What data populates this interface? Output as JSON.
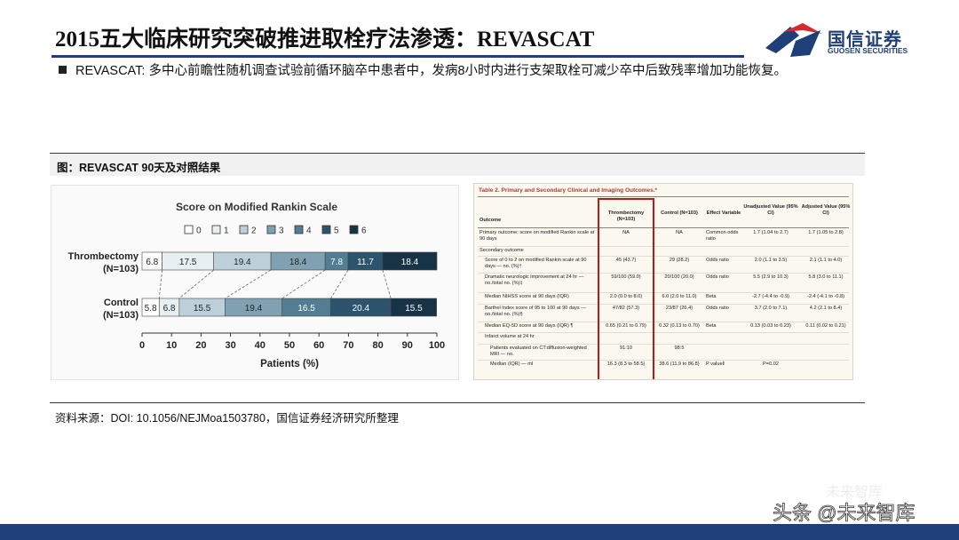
{
  "slide": {
    "title": "2015五大临床研究突破推进取栓疗法渗透：REVASCAT",
    "bullet": "REVASCAT: 多中心前瞻性随机调查试验前循环脑卒中患者中，发病8小时内进行支架取栓可减少卒中后致残率增加功能恢复。",
    "figure_caption": "图：REVASCAT 90天及对照结果",
    "source": "资料来源：DOI: 10.1056/NEJMoa1503780，国信证券经济研究所整理",
    "watermark_main": "头条 @未来智库",
    "watermark_secondary": "未来智库"
  },
  "logo": {
    "name": "国信证券",
    "sub": "GUOSEN SECURITIES",
    "colors": {
      "red": "#d7282f",
      "blue": "#1f3f79"
    }
  },
  "chart_data": {
    "type": "bar",
    "orientation": "horizontal-stacked",
    "title": "Score on Modified Rankin Scale",
    "xlabel": "Patients (%)",
    "xlim": [
      0,
      100
    ],
    "xticks": [
      0,
      10,
      20,
      30,
      40,
      50,
      60,
      70,
      80,
      90,
      100
    ],
    "legend": [
      "0",
      "1",
      "2",
      "3",
      "4",
      "5",
      "6"
    ],
    "legend_position": "top",
    "colors": [
      "#ffffff",
      "#e7eff2",
      "#bcd0d9",
      "#7fa1b2",
      "#527d93",
      "#2c556d",
      "#173447"
    ],
    "categories": [
      {
        "name": "Thrombectomy",
        "n": "(N=103)",
        "values": [
          6.8,
          17.5,
          19.4,
          18.4,
          7.8,
          11.7,
          18.4
        ]
      },
      {
        "name": "Control",
        "n": "(N=103)",
        "values": [
          5.8,
          6.8,
          15.5,
          19.4,
          16.5,
          20.4,
          15.5
        ]
      }
    ]
  },
  "table": {
    "title": "Table 2. Primary and Secondary Clinical and Imaging Outcomes.*",
    "headers": [
      "Outcome",
      "Thrombectomy (N=103)",
      "Control (N=103)",
      "Effect Variable",
      "Unadjusted Value (95% CI)",
      "Adjusted Value (95% CI)"
    ],
    "rows": [
      [
        "Primary outcome: score on modified Rankin scale at 90 days",
        "NA",
        "NA",
        "Common odds ratio",
        "1.7 (1.04 to 2.7)",
        "1.7 (1.05 to 2.8)"
      ],
      [
        "Secondary outcome",
        "",
        "",
        "",
        "",
        ""
      ],
      [
        "Score of 0 to 2 on modified Rankin scale at 90 days — no. (%)†",
        "45 (43.7)",
        "29 (28.2)",
        "Odds ratio",
        "2.0 (1.1 to 3.5)",
        "2.1 (1.1 to 4.0)"
      ],
      [
        "Dramatic neurologic improvement at 24 hr — no./total no. (%)‡",
        "59/100 (59.0)",
        "20/100 (20.0)",
        "Odds ratio",
        "5.5 (2.9 to 10.3)",
        "5.8 (3.0 to 11.1)"
      ],
      [
        "Median NIHSS score at 90 days (IQR)",
        "2.0 (0.0 to 8.0)",
        "6.0 (2.0 to 11.0)",
        "Beta",
        "-2.7 (-4.4 to -0.9)",
        "-2.4 (-4.1 to -0.8)"
      ],
      [
        "Barthel Index score of 95 to 100 at 90 days — no./total no. (%)§",
        "47/82 (57.3)",
        "23/87 (26.4)",
        "Odds ratio",
        "3.7 (2.0 to 7.1)",
        "4.2 (2.1 to 8.4)"
      ],
      [
        "Median EQ-5D score at 90 days (IQR) ¶",
        "0.65 (0.21 to 0.79)",
        "0.32 (0.13 to 0.70)",
        "Beta",
        "0.13 (0.03 to 0.23)",
        "0.11 (0.02 to 0.21)"
      ],
      [
        "Infarct volume at 24 hr",
        "",
        "",
        "",
        "",
        ""
      ],
      [
        "Patients evaluated on CT:diffusion-weighted MRI — no.",
        "91:10",
        "98:5",
        "",
        "",
        ""
      ],
      [
        "Median (IQR) — ml",
        "16.3 (8.3 to 58.5)",
        "38.6 (11.9 to 86.8)",
        "P value‖",
        "P=0.02",
        ""
      ]
    ]
  }
}
